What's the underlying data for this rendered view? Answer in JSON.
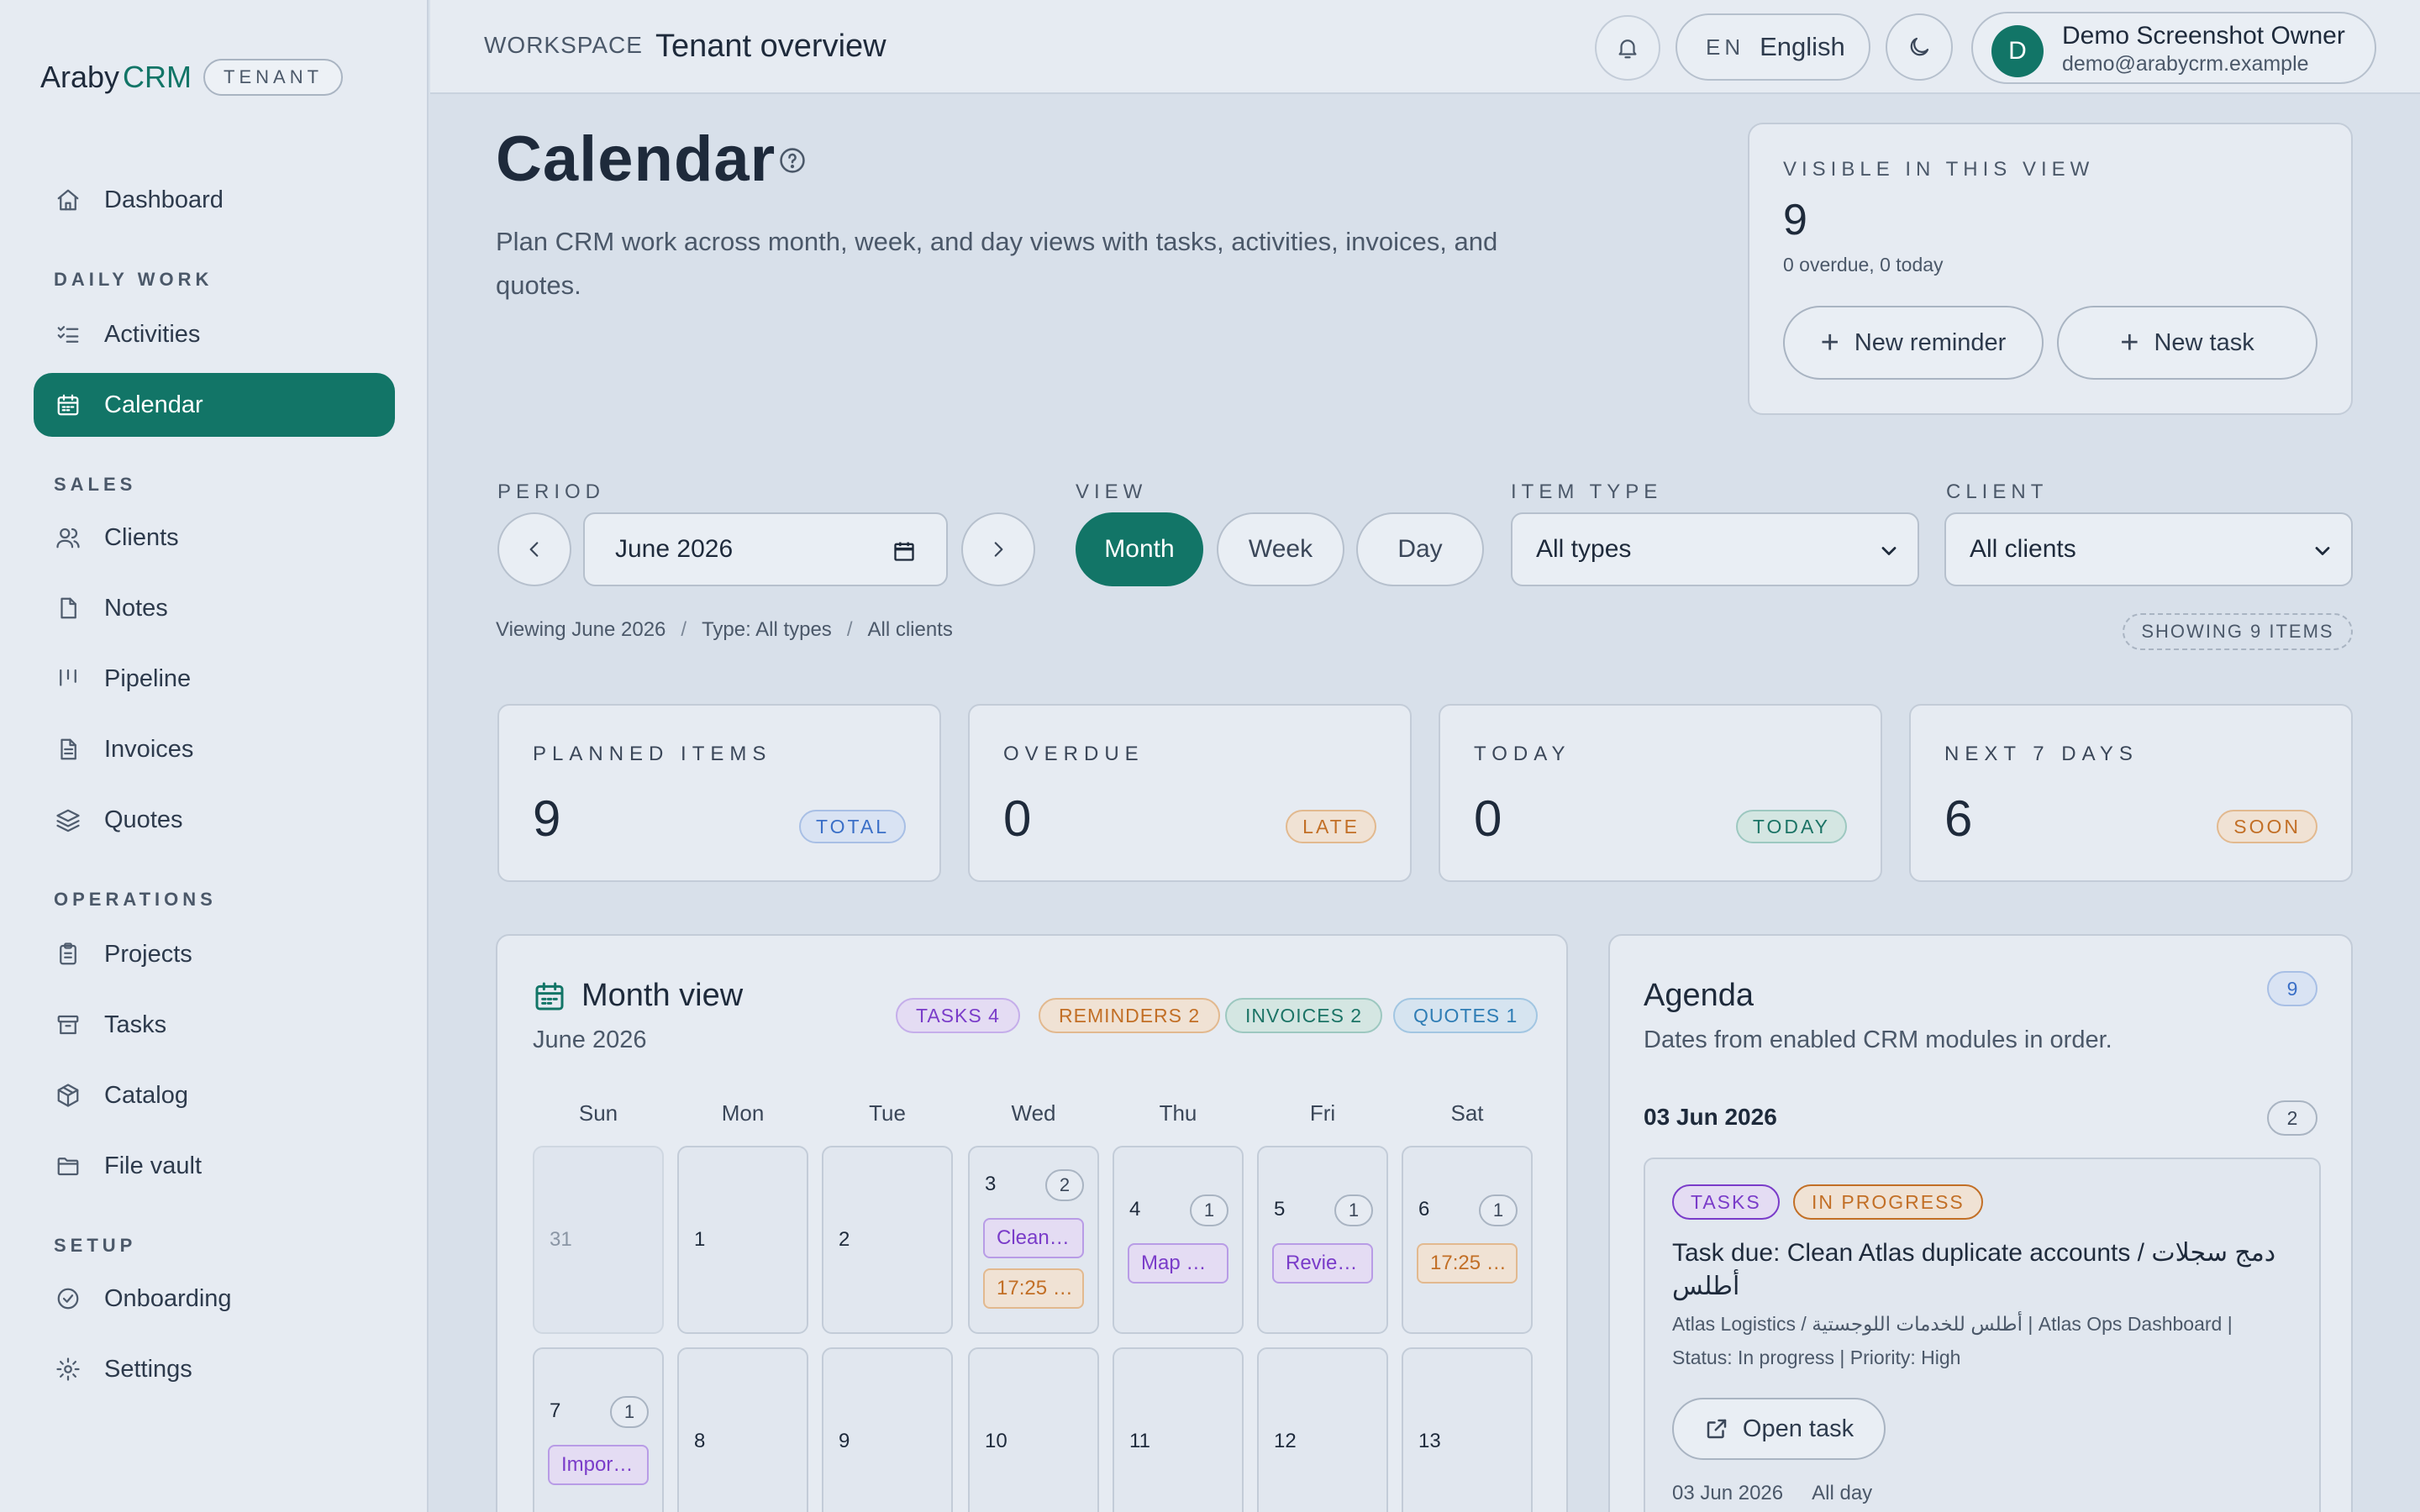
{
  "brand": {
    "name_a": "Araby",
    "name_b": "CRM",
    "badge": "TENANT"
  },
  "sidebar": {
    "sections": {
      "daily": "DAILY WORK",
      "sales": "SALES",
      "operations": "OPERATIONS",
      "setup": "SETUP"
    },
    "items": [
      {
        "label": "Dashboard",
        "icon": "home-icon"
      },
      {
        "label": "Activities",
        "icon": "checklist-icon"
      },
      {
        "label": "Calendar",
        "icon": "calendar-icon",
        "active": true
      },
      {
        "label": "Clients",
        "icon": "users-icon"
      },
      {
        "label": "Notes",
        "icon": "file-icon"
      },
      {
        "label": "Pipeline",
        "icon": "kanban-icon"
      },
      {
        "label": "Invoices",
        "icon": "receipt-icon"
      },
      {
        "label": "Quotes",
        "icon": "layers-icon"
      },
      {
        "label": "Projects",
        "icon": "clipboard-icon"
      },
      {
        "label": "Tasks",
        "icon": "archive-icon"
      },
      {
        "label": "Catalog",
        "icon": "package-icon"
      },
      {
        "label": "File vault",
        "icon": "folder-icon"
      },
      {
        "label": "Onboarding",
        "icon": "check-circle-icon"
      },
      {
        "label": "Settings",
        "icon": "gear-icon"
      }
    ]
  },
  "topbar": {
    "workspace": "WORKSPACE",
    "title": "Tenant overview",
    "lang_code": "EN",
    "lang_name": "English",
    "user_initial": "D",
    "user_name": "Demo Screenshot Owner",
    "user_email": "demo@arabycrm.example"
  },
  "header": {
    "title": "Calendar",
    "subtitle": "Plan CRM work across month, week, and day views with tasks, activities, invoices, and quotes."
  },
  "visible": {
    "label": "VISIBLE IN THIS VIEW",
    "count": "9",
    "sub": "0 overdue, 0 today",
    "new_reminder": "New reminder",
    "new_task": "New task"
  },
  "filters": {
    "period_label": "PERIOD",
    "period_value": "June 2026",
    "view_label": "VIEW",
    "views": [
      "Month",
      "Week",
      "Day"
    ],
    "active_view": "Month",
    "type_label": "ITEM TYPE",
    "type_value": "All types",
    "client_label": "CLIENT",
    "client_value": "All clients"
  },
  "crumbs": [
    "Viewing June 2026",
    "Type: All types",
    "All clients"
  ],
  "crumb_sep": "/",
  "showing": "SHOWING 9 ITEMS",
  "stats": [
    {
      "label": "PLANNED ITEMS",
      "value": "9",
      "badge": "TOTAL"
    },
    {
      "label": "OVERDUE",
      "value": "0",
      "badge": "LATE"
    },
    {
      "label": "TODAY",
      "value": "0",
      "badge": "TODAY"
    },
    {
      "label": "NEXT 7 DAYS",
      "value": "6",
      "badge": "SOON"
    }
  ],
  "month_view": {
    "title": "Month view",
    "subtitle": "June 2026",
    "chips": [
      "TASKS 4",
      "REMINDERS 2",
      "INVOICES 2",
      "QUOTES 1"
    ],
    "weekdays": [
      "Sun",
      "Mon",
      "Tue",
      "Wed",
      "Thu",
      "Fri",
      "Sat"
    ],
    "week1": [
      {
        "num": "31",
        "muted": true
      },
      {
        "num": "1"
      },
      {
        "num": "2"
      },
      {
        "num": "3",
        "count": "2",
        "events": [
          "Clean…",
          "17:25 …"
        ]
      },
      {
        "num": "4",
        "count": "1",
        "events": [
          "Map …"
        ]
      },
      {
        "num": "5",
        "count": "1",
        "events": [
          "Revie…"
        ]
      },
      {
        "num": "6",
        "count": "1",
        "events": [
          "17:25 …"
        ]
      }
    ],
    "week2": [
      {
        "num": "7",
        "count": "1",
        "events": [
          "Impor…"
        ]
      },
      {
        "num": "8"
      },
      {
        "num": "9"
      },
      {
        "num": "10"
      },
      {
        "num": "11"
      },
      {
        "num": "12"
      },
      {
        "num": "13"
      }
    ]
  },
  "agenda": {
    "title": "Agenda",
    "count": "9",
    "subtitle": "Dates from enabled CRM modules in order.",
    "date": "03 Jun 2026",
    "date_count": "2",
    "item": {
      "tag1": "TASKS",
      "tag2": "IN PROGRESS",
      "title": "Task due: Clean Atlas duplicate accounts / دمج سجلات أطلس",
      "meta": "Atlas Logistics / أطلس للخدمات اللوجستية | Atlas Ops Dashboard | Status: In progress | Priority: High",
      "open": "Open task",
      "foot_date": "03 Jun 2026",
      "foot_time": "All day"
    }
  },
  "colors": {
    "accent": "#127567",
    "background": "#d8e0ea",
    "surface": "#e6ebf2",
    "task": "#7a3cc9",
    "reminder": "#c26f26",
    "invoice": "#1c7466",
    "quote": "#2f7db5"
  }
}
